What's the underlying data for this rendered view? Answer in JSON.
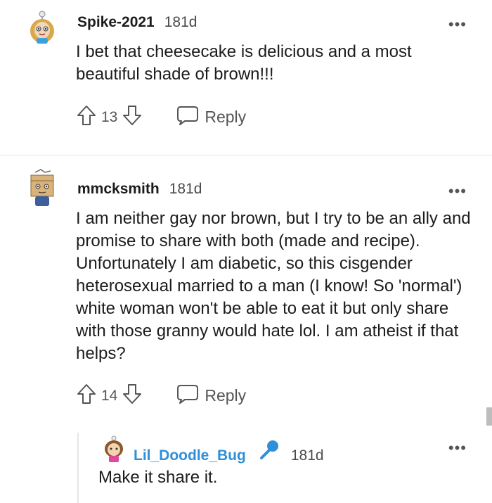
{
  "comments": [
    {
      "username": "Spike-2021",
      "age": "181d",
      "text": "I bet that cheesecake is delicious and a most beautiful shade of brown!!!",
      "votes": "13",
      "reply_label": "Reply",
      "more": "•••"
    },
    {
      "username": "mmcksmith",
      "age": "181d",
      "text": "I am neither gay nor brown, but I try to be an ally and promise to share with both (made and recipe). Unfortunately I am diabetic, so this cisgender heterosexual married to a man (I know! So 'normal') white woman won't be able to eat it but only share with those granny would hate lol. I am atheist if that helps?",
      "votes": "14",
      "reply_label": "Reply",
      "more": "•••"
    },
    {
      "username": "Lil_Doodle_Bug",
      "age": "181d",
      "text": "Make it share it.",
      "more": "•••"
    }
  ],
  "colors": {
    "username_highlight": "#2f8fd8",
    "mic_icon": "#2f8fd8",
    "text": "#1c1c1c",
    "meta": "#4a4a4a"
  },
  "icons": [
    "upvote-icon",
    "downvote-icon",
    "reply-bubble-icon",
    "more-options-icon",
    "microphone-icon"
  ]
}
